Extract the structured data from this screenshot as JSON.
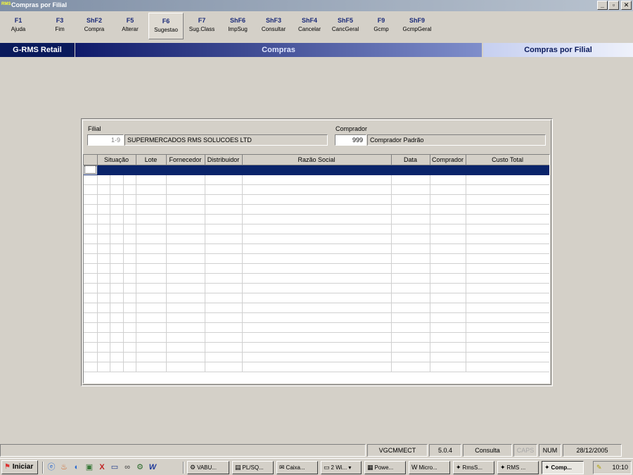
{
  "window": {
    "title": "Compras por Filial",
    "app_icon": "rms-app-icon",
    "buttons": [
      "_",
      "▫",
      "✕"
    ]
  },
  "fkeys": [
    {
      "key": "F1",
      "label": "Ajuda"
    },
    {
      "key": "F3",
      "label": "Fim"
    },
    {
      "key": "ShF2",
      "label": "Compra"
    },
    {
      "key": "F5",
      "label": "Alterar"
    },
    {
      "key": "F6",
      "label": "Sugestao"
    },
    {
      "key": "F7",
      "label": "Sug.Class"
    },
    {
      "key": "ShF6",
      "label": "ImpSug"
    },
    {
      "key": "ShF3",
      "label": "Consultar"
    },
    {
      "key": "ShF4",
      "label": "Cancelar"
    },
    {
      "key": "ShF5",
      "label": "CancGeral"
    },
    {
      "key": "F9",
      "label": "Gcmp"
    },
    {
      "key": "ShF9",
      "label": "GcmpGeral"
    }
  ],
  "banner": {
    "left": "G-RMS Retail",
    "center": "Compras",
    "right": "Compras por Filial"
  },
  "form": {
    "filial_label": "Filial",
    "filial_code": "1-9",
    "filial_name": "SUPERMERCADOS RMS SOLUCOES LTD",
    "comprador_label": "Comprador",
    "comprador_code": "999",
    "comprador_name": "Comprador Padrão"
  },
  "grid": {
    "columns": [
      "",
      "Situação",
      "",
      "",
      "Lote",
      "Fornecedor",
      "Distribuidor",
      "Razão Social",
      "Data",
      "Comprador",
      "Custo Total"
    ],
    "rows": 21
  },
  "status": {
    "left": "",
    "user": "VGCMMECT",
    "version": "5.0.4",
    "mode": "Consulta",
    "caps": "CAPS",
    "num": "NUM",
    "date": "28/12/2005"
  },
  "taskbar": {
    "start": "Iniciar",
    "quick_icons": [
      "ie-icon",
      "java-icon",
      "shell-icon",
      "computer-icon",
      "excel-x-icon",
      "desktop-icon",
      "binoculars-icon",
      "network-icon",
      "word-icon"
    ],
    "tasks": [
      "VABU...",
      "PL/SQ...",
      "Caixa...",
      "2 Wi...",
      "Powe...",
      "Micro...",
      "RmsS...",
      "RMS ...",
      "Comp..."
    ],
    "clock": "10:10"
  },
  "colors": {
    "banner_dark": "#0a1a5c",
    "selection": "#0a246a",
    "fkey_text": "#1a2a78"
  }
}
